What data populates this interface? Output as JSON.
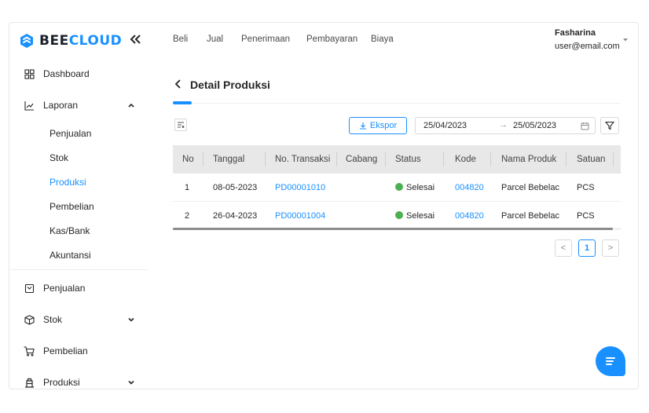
{
  "brand": {
    "prefix": "BEE",
    "suffix": "CLOUD",
    "collapse_icon": "double-chevron-left-icon",
    "accent": "#1890ff"
  },
  "sidebar": {
    "items": [
      {
        "label": "Dashboard",
        "icon": "dashboard-grid-icon"
      },
      {
        "label": "Laporan",
        "icon": "line-chart-icon",
        "expanded": true,
        "children": [
          "Penjualan",
          "Stok",
          "Produksi",
          "Pembelian",
          "Kas/Bank",
          "Akuntansi"
        ],
        "active_child": "Produksi"
      },
      {
        "label": "Penjualan",
        "icon": "receipt-icon"
      },
      {
        "label": "Stok",
        "icon": "box-icon",
        "expanded": false
      },
      {
        "label": "Pembelian",
        "icon": "cart-icon"
      },
      {
        "label": "Produksi",
        "icon": "factory-icon",
        "expanded": false
      }
    ]
  },
  "header": {
    "nav": [
      "Beli",
      "Jual",
      "Penerimaan",
      "Pembayaran",
      "Biaya"
    ],
    "user": {
      "name": "Fasharina",
      "email": "user@email.com"
    }
  },
  "page": {
    "title": "Detail Produksi",
    "export_label": "Ekspor",
    "date_start": "25/04/2023",
    "date_end": "25/05/2023",
    "date_arrow": "→"
  },
  "table": {
    "columns": [
      "No",
      "Tanggal",
      "No. Transaksi",
      "Cabang",
      "Status",
      "Kode",
      "Nama Produk",
      "Satuan"
    ],
    "rows": [
      {
        "no": "1",
        "tanggal": "08-05-2023",
        "transaksi": "PD00001010",
        "cabang": "",
        "status": "Selesai",
        "kode": "004820",
        "produk": "Parcel Bebelac",
        "satuan": "PCS"
      },
      {
        "no": "2",
        "tanggal": "26-04-2023",
        "transaksi": "PD00001004",
        "cabang": "",
        "status": "Selesai",
        "kode": "004820",
        "produk": "Parcel Bebelac",
        "satuan": "PCS"
      }
    ],
    "status_color": "#4caf50"
  },
  "pagination": {
    "prev": "<",
    "current": "1",
    "next": ">"
  },
  "chat": {
    "icon": "chat-icon"
  }
}
